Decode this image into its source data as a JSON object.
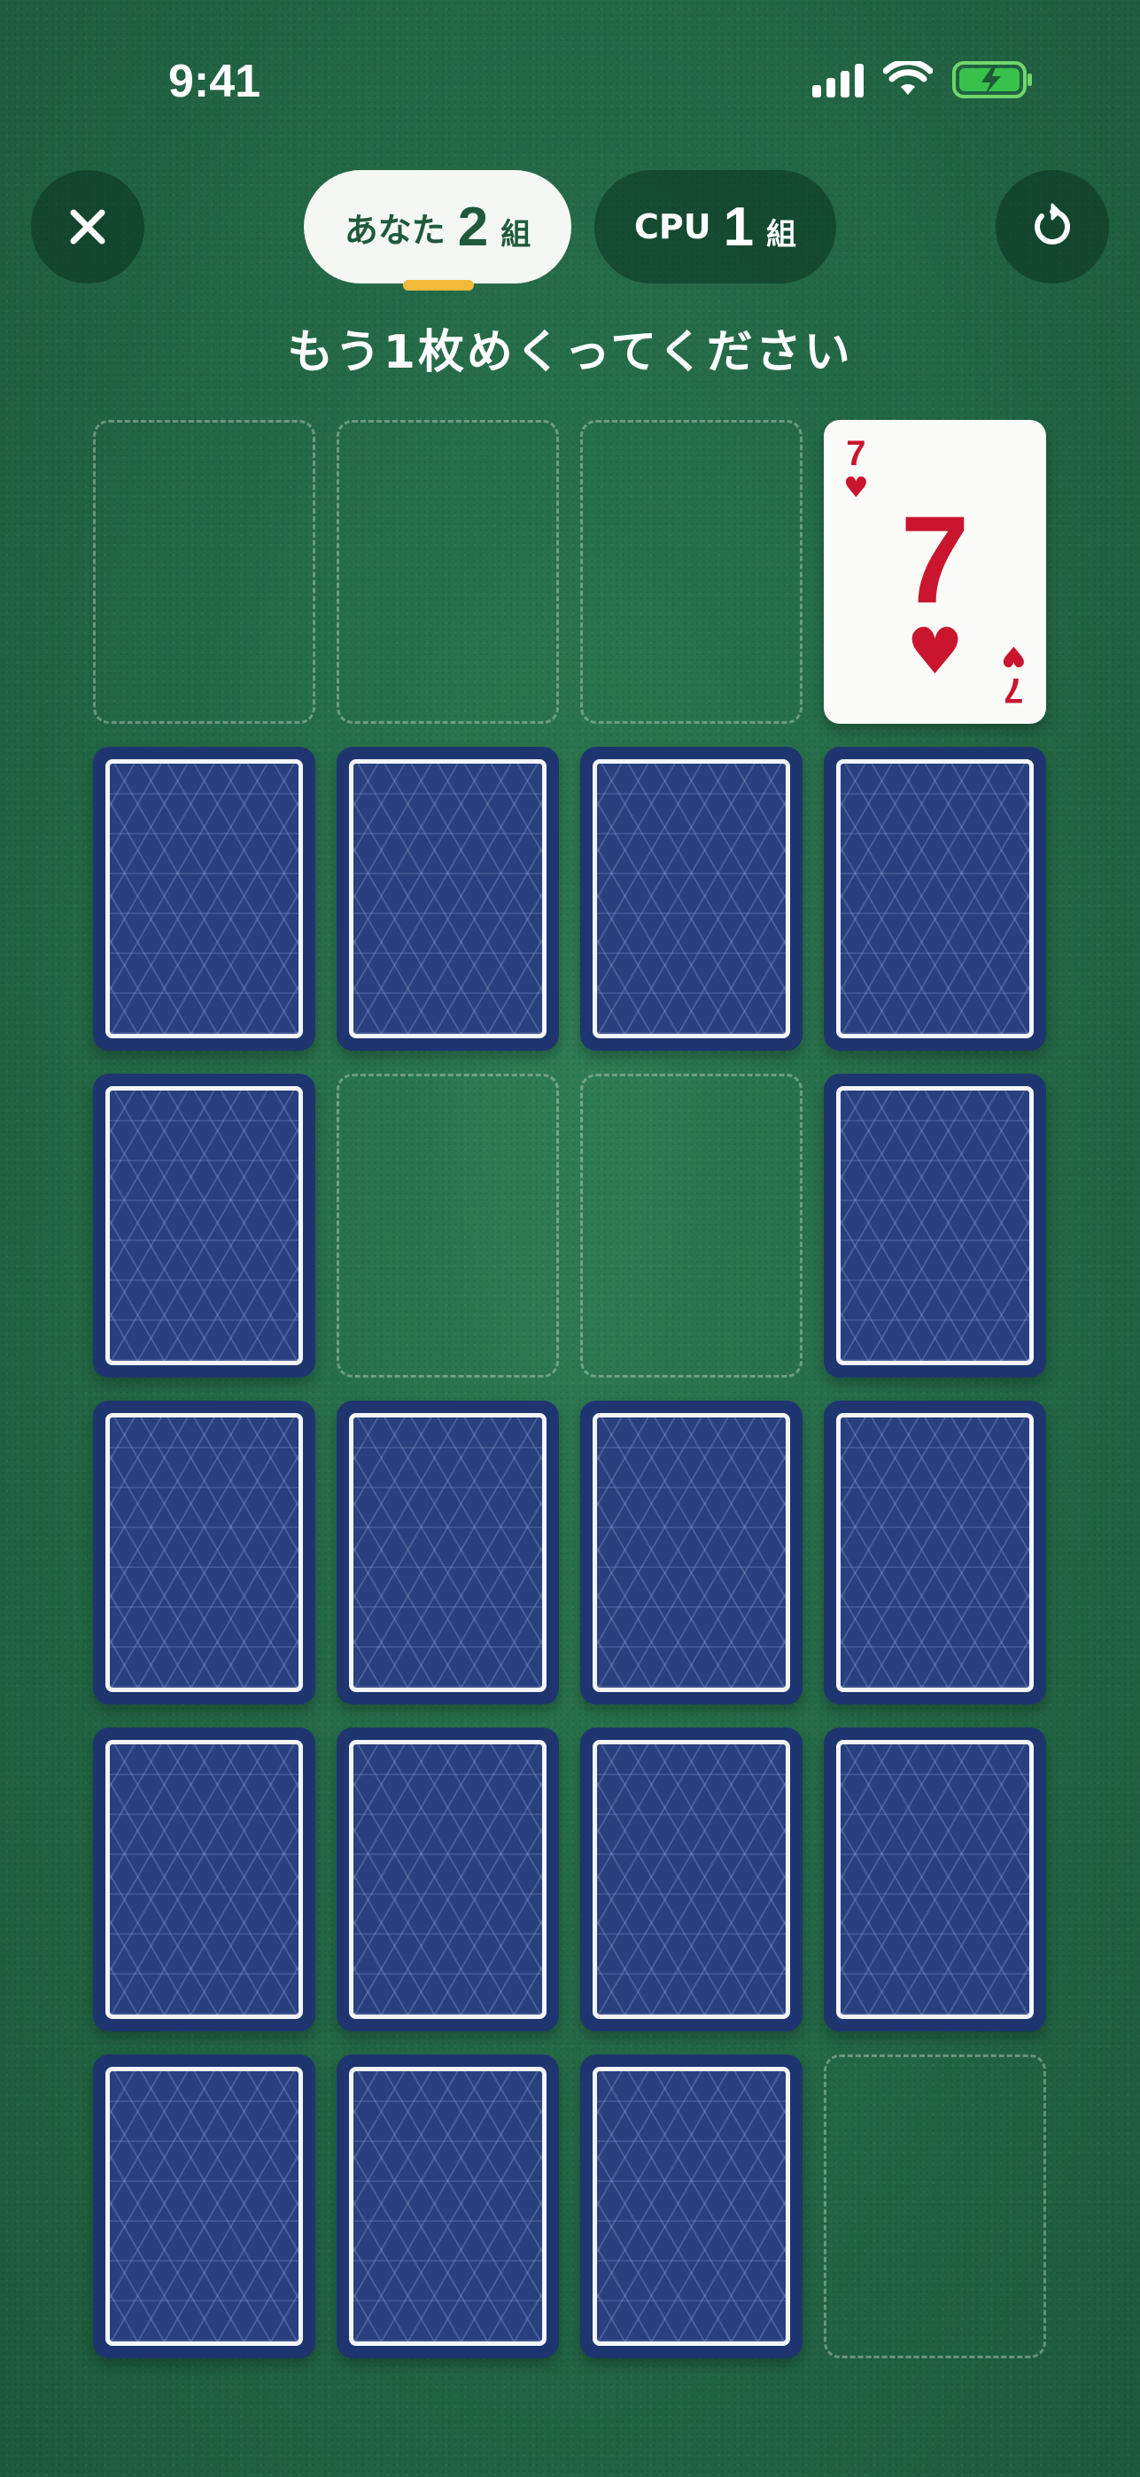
{
  "status_bar": {
    "time": "9:41",
    "icons": [
      "signal-icon",
      "wifi-icon",
      "battery-charging-icon"
    ]
  },
  "toolbar": {
    "close_icon": "close-icon",
    "reset_icon": "restart-icon"
  },
  "scores": {
    "player": {
      "label": "あなた",
      "count": "2",
      "unit": "組",
      "active": true
    },
    "cpu": {
      "label": "CPU",
      "count": "1",
      "unit": "組",
      "active": false
    }
  },
  "colors": {
    "table_green": "#256b48",
    "card_back_navy": "#1e3570",
    "active_indicator": "#f3b93a",
    "heart_red": "#c9152e"
  },
  "instruction": "もう1枚めくってください",
  "board": {
    "columns": 4,
    "cells": [
      {
        "state": "removed"
      },
      {
        "state": "removed"
      },
      {
        "state": "removed"
      },
      {
        "state": "face-up",
        "rank": "7",
        "suit": "♥",
        "suit_name": "hearts"
      },
      {
        "state": "face-down"
      },
      {
        "state": "face-down"
      },
      {
        "state": "face-down"
      },
      {
        "state": "face-down"
      },
      {
        "state": "face-down"
      },
      {
        "state": "removed"
      },
      {
        "state": "removed"
      },
      {
        "state": "face-down"
      },
      {
        "state": "face-down"
      },
      {
        "state": "face-down"
      },
      {
        "state": "face-down"
      },
      {
        "state": "face-down"
      },
      {
        "state": "face-down"
      },
      {
        "state": "face-down"
      },
      {
        "state": "face-down"
      },
      {
        "state": "face-down"
      },
      {
        "state": "face-down"
      },
      {
        "state": "face-down"
      },
      {
        "state": "face-down"
      },
      {
        "state": "removed"
      }
    ]
  }
}
